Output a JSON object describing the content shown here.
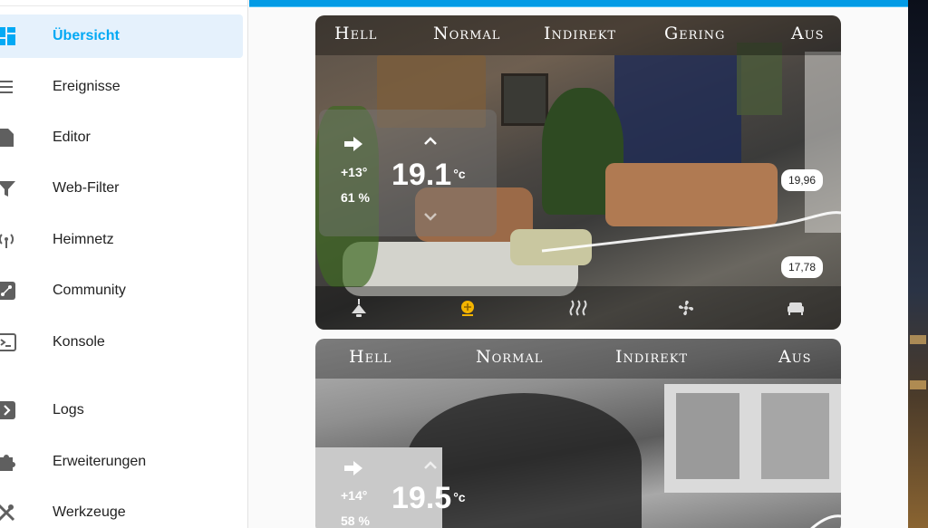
{
  "sidebar": {
    "items": [
      {
        "label": "Übersicht",
        "icon": "dashboard-icon",
        "active": true
      },
      {
        "label": "Ereignisse",
        "icon": "list-icon",
        "active": false
      },
      {
        "label": "Editor",
        "icon": "file-icon",
        "active": false
      },
      {
        "label": "Web-Filter",
        "icon": "filter-icon",
        "active": false
      },
      {
        "label": "Heimnetz",
        "icon": "wifi-router-icon",
        "active": false
      },
      {
        "label": "Community",
        "icon": "graph-icon",
        "active": false
      },
      {
        "label": "Konsole",
        "icon": "terminal-icon",
        "active": false
      },
      {
        "label": "Logs",
        "icon": "chevron-box-icon",
        "active": false
      },
      {
        "label": "Erweiterungen",
        "icon": "puzzle-icon",
        "active": false
      },
      {
        "label": "Werkzeuge",
        "icon": "tools-icon",
        "active": false
      }
    ]
  },
  "colors": {
    "accent": "#03a9f4",
    "active_bg": "#e5f1fc",
    "topbar": "#039be5",
    "fan_active": "#f4b400"
  },
  "cards": [
    {
      "modes": [
        "Hell",
        "Normal",
        "Indirekt",
        "Gering",
        "Aus"
      ],
      "temperature": "19.1",
      "unit": "°c",
      "outside_delta": "+13°",
      "humidity": "61 %",
      "graph_max": "19,96",
      "graph_min": "17,78",
      "icons": [
        "ceiling-light-icon",
        "fan-icon",
        "heating-icon",
        "fan-blades-icon",
        "sofa-icon"
      ]
    },
    {
      "modes": [
        "Hell",
        "Normal",
        "Indirekt",
        "Aus"
      ],
      "temperature": "19.5",
      "unit": "°c",
      "outside_delta": "+14°",
      "humidity": "58 %"
    }
  ]
}
